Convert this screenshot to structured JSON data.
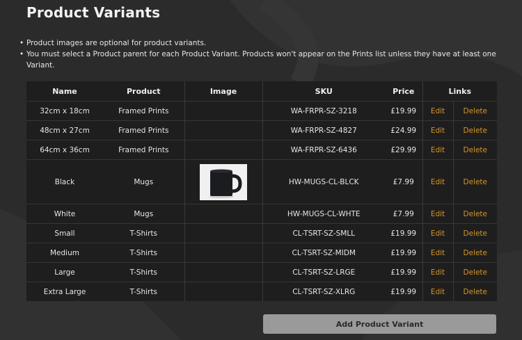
{
  "page": {
    "title": "Product Variants",
    "notes": [
      "Product images are optional for product variants.",
      "You must select a Product parent for each Product Variant. Products won't appear on the Prints list unless they have at least one Variant."
    ]
  },
  "table": {
    "headers": [
      "Name",
      "Product",
      "Image",
      "SKU",
      "Price",
      "Links"
    ],
    "rows": [
      {
        "name": "32cm x 18cm",
        "product": "Framed Prints",
        "image": "",
        "sku": "WA-FRPR-SZ-3218",
        "price": "£19.99",
        "edit": "Edit",
        "delete": "Delete"
      },
      {
        "name": "48cm x 27cm",
        "product": "Framed Prints",
        "image": "",
        "sku": "WA-FRPR-SZ-4827",
        "price": "£24.99",
        "edit": "Edit",
        "delete": "Delete"
      },
      {
        "name": "64cm x 36cm",
        "product": "Framed Prints",
        "image": "",
        "sku": "WA-FRPR-SZ-6436",
        "price": "£29.99",
        "edit": "Edit",
        "delete": "Delete"
      },
      {
        "name": "Black",
        "product": "Mugs",
        "image": "black-mug",
        "sku": "HW-MUGS-CL-BLCK",
        "price": "£7.99",
        "edit": "Edit",
        "delete": "Delete"
      },
      {
        "name": "White",
        "product": "Mugs",
        "image": "",
        "sku": "HW-MUGS-CL-WHTE",
        "price": "£7.99",
        "edit": "Edit",
        "delete": "Delete"
      },
      {
        "name": "Small",
        "product": "T-Shirts",
        "image": "",
        "sku": "CL-TSRT-SZ-SMLL",
        "price": "£19.99",
        "edit": "Edit",
        "delete": "Delete"
      },
      {
        "name": "Medium",
        "product": "T-Shirts",
        "image": "",
        "sku": "CL-TSRT-SZ-MIDM",
        "price": "£19.99",
        "edit": "Edit",
        "delete": "Delete"
      },
      {
        "name": "Large",
        "product": "T-Shirts",
        "image": "",
        "sku": "CL-TSRT-SZ-LRGE",
        "price": "£19.99",
        "edit": "Edit",
        "delete": "Delete"
      },
      {
        "name": "Extra Large",
        "product": "T-Shirts",
        "image": "",
        "sku": "CL-TSRT-SZ-XLRG",
        "price": "£19.99",
        "edit": "Edit",
        "delete": "Delete"
      }
    ]
  },
  "actions": {
    "add_label": "Add Product Variant"
  },
  "colors": {
    "background": "#2b2b2b",
    "table": "#1e1e1e",
    "link": "#d4952a",
    "button": "#9a9a9a"
  }
}
